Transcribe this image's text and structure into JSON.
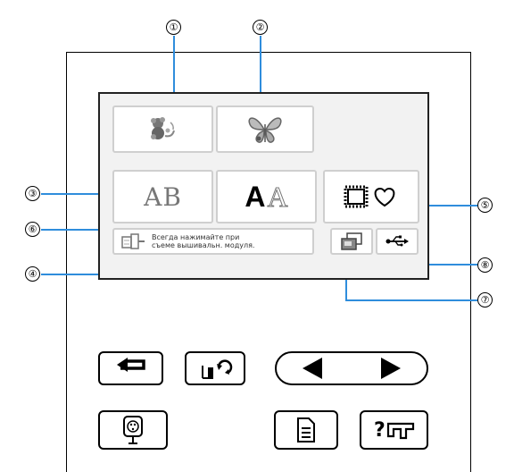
{
  "callouts": [
    "①",
    "②",
    "③",
    "④",
    "⑤",
    "⑥",
    "⑦",
    "⑧"
  ],
  "screen": {
    "keys": {
      "embroidery_pattern": "embroidery-pattern-icon",
      "butterfly_pattern": "butterfly-icon",
      "alphabet_ab": "AB",
      "alphabet_aa_bold": "A",
      "alphabet_aa_outline": "A",
      "frame_shapes": "frame-heart-icon"
    },
    "message": {
      "line1": "Всегда нажимайте при",
      "line2": "съеме вышивальн. модуля."
    }
  },
  "accent_color": "#2f8ddc"
}
